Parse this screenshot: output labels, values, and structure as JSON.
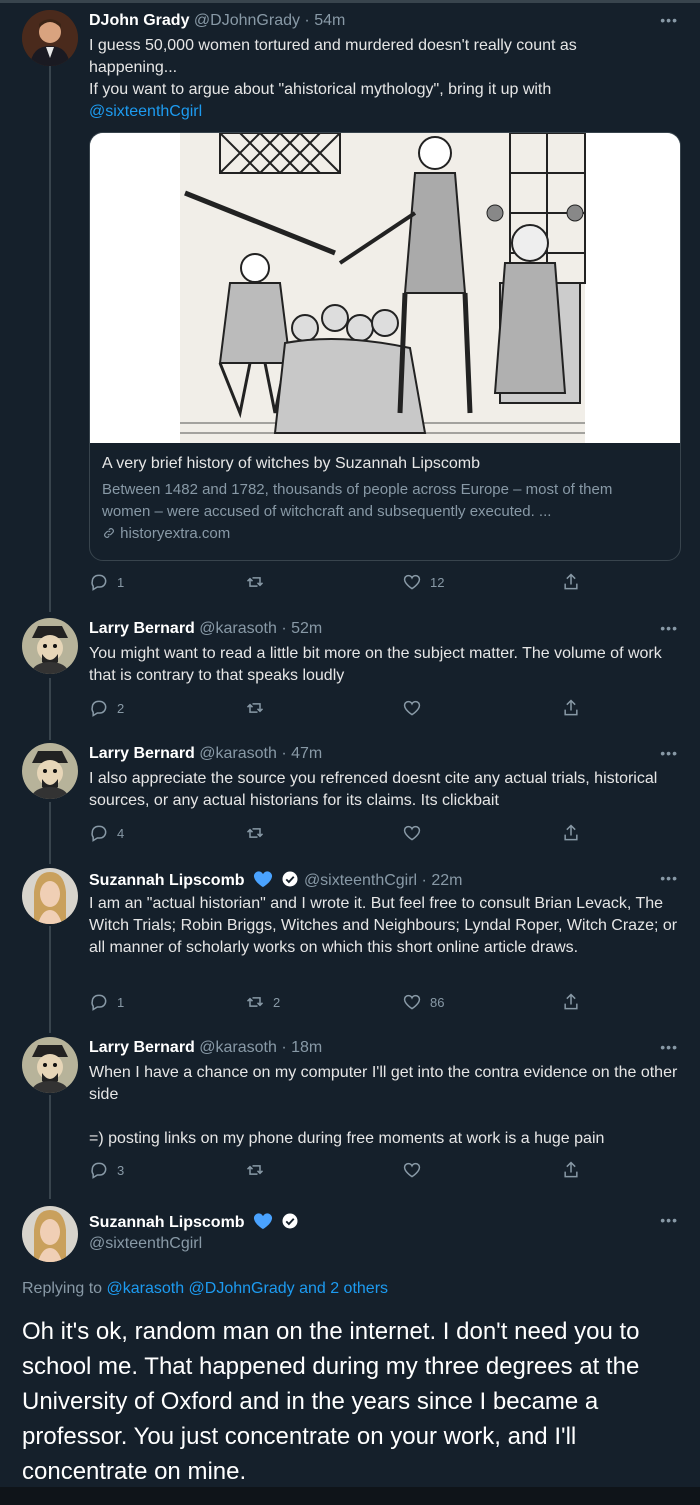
{
  "tweets": [
    {
      "name": "DJohn Grady",
      "handle": "@DJohnGrady · 54m",
      "text_line1": "I guess 50,000 women tortured and murdered doesn't really count as",
      "text_line2": "happening...",
      "text_line3": "If you want to argue about \"ahistorical mythology\", bring it up with",
      "mention": "@sixteenthCgirl",
      "card": {
        "title": "A very brief history of witches by Suzannah Lipscomb",
        "description": "Between 1482 and 1782, thousands of people across Europe – most of them women – were accused of witchcraft and subsequently executed. ...",
        "domain": "historyextra.com"
      },
      "replies": "1",
      "retweets": "",
      "likes": "12"
    },
    {
      "name": "Larry Bernard",
      "handle": "@karasoth · 52m",
      "text": "You might want to read a little bit more on the subject matter. The volume of work that is contrary to that speaks loudly",
      "replies": "2",
      "retweets": "",
      "likes": ""
    },
    {
      "name": "Larry Bernard",
      "handle": "@karasoth · 47m",
      "text": "I also appreciate the source you refrenced doesnt cite any actual trials, historical sources, or any actual historians for its claims. Its clickbait",
      "replies": "4",
      "retweets": "",
      "likes": ""
    },
    {
      "name": "Suzannah Lipscomb",
      "handle": "@sixteenthCgirl · 22m",
      "text": "I am an \"actual historian\" and I wrote it. But feel free to consult Brian Levack, The Witch Trials; Robin Briggs, Witches and Neighbours; Lyndal Roper, Witch Craze; or all manner of scholarly works on which this short online article draws.",
      "replies": "1",
      "retweets": "2",
      "likes": "86"
    },
    {
      "name": "Larry Bernard",
      "handle": "@karasoth · 18m",
      "text1": "When I have a chance on my computer I'll get into the contra evidence on the other side",
      "text2": "=) posting links on my phone during free moments at work is a huge pain",
      "replies": "3",
      "retweets": "",
      "likes": ""
    }
  ],
  "main_tweet": {
    "name": "Suzannah Lipscomb",
    "handle": "@sixteenthCgirl",
    "replying_prefix": "Replying to",
    "replying_to": "@karasoth @DJohnGrady and 2 others",
    "text": "Oh it's ok, random man on the internet. I don't need you to school me. That happened during my three degrees at the University of Oxford and in the years since I became a professor. You just concentrate on your work, and I'll concentrate on mine."
  },
  "more_icon": "•••",
  "colors": {
    "background": "#15202b",
    "accent": "#1d9bf0",
    "muted": "#8899a6",
    "verified_heart": "#4aa3ff"
  }
}
